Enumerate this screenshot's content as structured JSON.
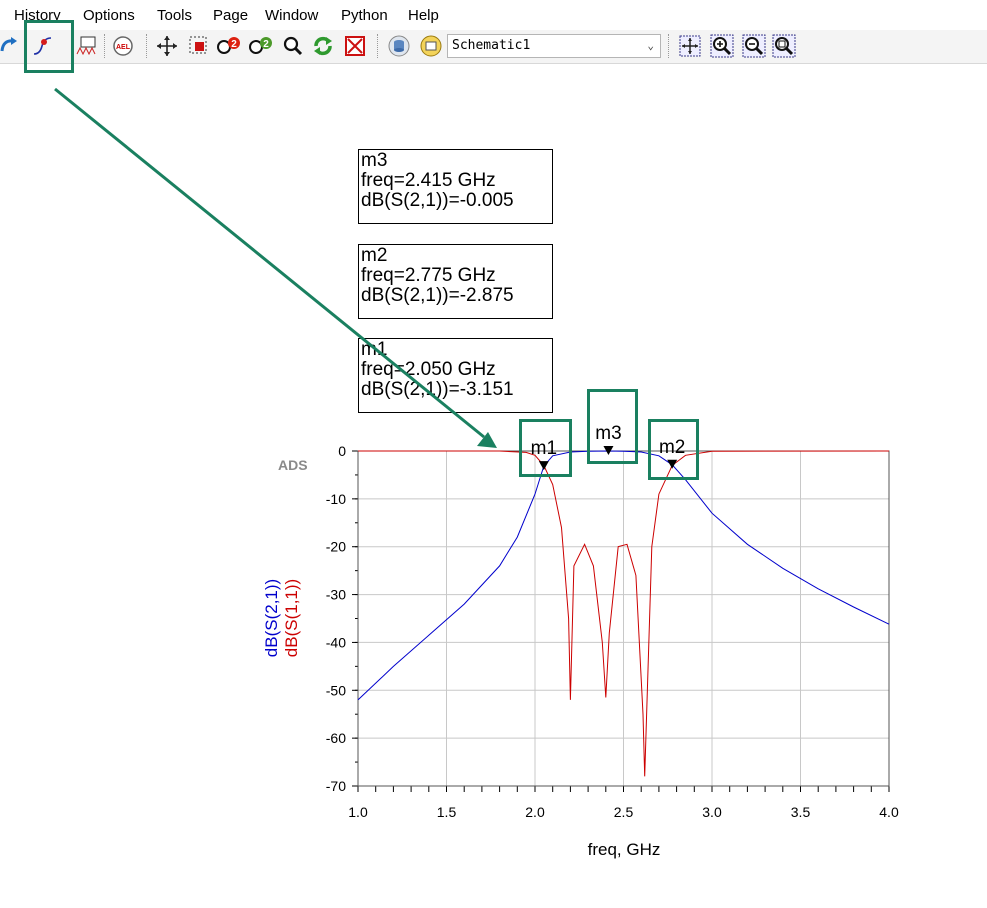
{
  "menu": [
    "History",
    "Options",
    "Tools",
    "Page",
    "Window",
    "Python",
    "Help"
  ],
  "toolbar": {
    "icons": [
      "redo-icon",
      "trace-icon",
      "data-file-icon",
      "ael-icon",
      "move-icon",
      "zoom-area-icon",
      "zoom-in-icon",
      "zoom-out-icon",
      "zoom-icon",
      "refresh-icon",
      "delete-icon",
      "database-icon",
      "display-icon",
      "view-all-icon",
      "zoom-plus-icon",
      "zoom-minus-icon",
      "zoom-fit-icon"
    ],
    "ael_label": "AEL",
    "schematic_value": "Schematic1"
  },
  "markers": [
    {
      "name": "m3",
      "freq": "freq=2.415 GHz",
      "value": "dB(S(2,1))=-0.005"
    },
    {
      "name": "m2",
      "freq": "freq=2.775 GHz",
      "value": "dB(S(2,1))=-2.875"
    },
    {
      "name": "m1",
      "freq": "freq=2.050 GHz",
      "value": "dB(S(2,1))=-3.151"
    }
  ],
  "chart_data": {
    "type": "line",
    "watermark": "ADS",
    "xlabel": "freq, GHz",
    "ylabel_series": [
      "dB(S(2,1))",
      "dB(S(1,1))"
    ],
    "xlim": [
      1.0,
      4.0
    ],
    "ylim": [
      -70,
      0
    ],
    "xticks": [
      "1.0",
      "1.5",
      "2.0",
      "2.5",
      "3.0",
      "3.5",
      "4.0"
    ],
    "yticks": [
      "0",
      "-10",
      "-20",
      "-30",
      "-40",
      "-50",
      "-60",
      "-70"
    ],
    "grid": true,
    "series": [
      {
        "name": "dB(S(2,1))",
        "color": "#0000cc",
        "x": [
          1.0,
          1.2,
          1.4,
          1.6,
          1.8,
          1.9,
          2.0,
          2.05,
          2.1,
          2.2,
          2.3,
          2.415,
          2.5,
          2.6,
          2.7,
          2.775,
          2.85,
          3.0,
          3.2,
          3.4,
          3.6,
          3.8,
          4.0
        ],
        "y": [
          -52,
          -45,
          -38.5,
          -32,
          -24,
          -18,
          -9,
          -3.151,
          -1,
          -0.2,
          -0.05,
          -0.005,
          -0.05,
          -0.2,
          -1,
          -2.875,
          -6,
          -13,
          -19.5,
          -24.5,
          -28.8,
          -32.6,
          -36.2
        ]
      },
      {
        "name": "dB(S(1,1))",
        "color": "#cc0000",
        "x": [
          1.0,
          1.8,
          1.95,
          2.0,
          2.05,
          2.1,
          2.15,
          2.19,
          2.2,
          2.22,
          2.28,
          2.33,
          2.38,
          2.4,
          2.42,
          2.47,
          2.52,
          2.57,
          2.61,
          2.62,
          2.66,
          2.7,
          2.775,
          2.85,
          3.0,
          4.0
        ],
        "y": [
          0,
          0,
          -0.3,
          -0.9,
          -3.0,
          -7,
          -16,
          -35,
          -52,
          -24,
          -19.5,
          -24,
          -40,
          -51.5,
          -38,
          -20,
          -19.5,
          -26,
          -55,
          -68,
          -20,
          -9,
          -3.0,
          -0.9,
          -0.05,
          0
        ]
      }
    ],
    "markers": [
      {
        "label": "m1",
        "x": 2.05,
        "y": -3.151
      },
      {
        "label": "m3",
        "x": 2.415,
        "y": -0.005
      },
      {
        "label": "m2",
        "x": 2.775,
        "y": -2.875
      }
    ]
  }
}
